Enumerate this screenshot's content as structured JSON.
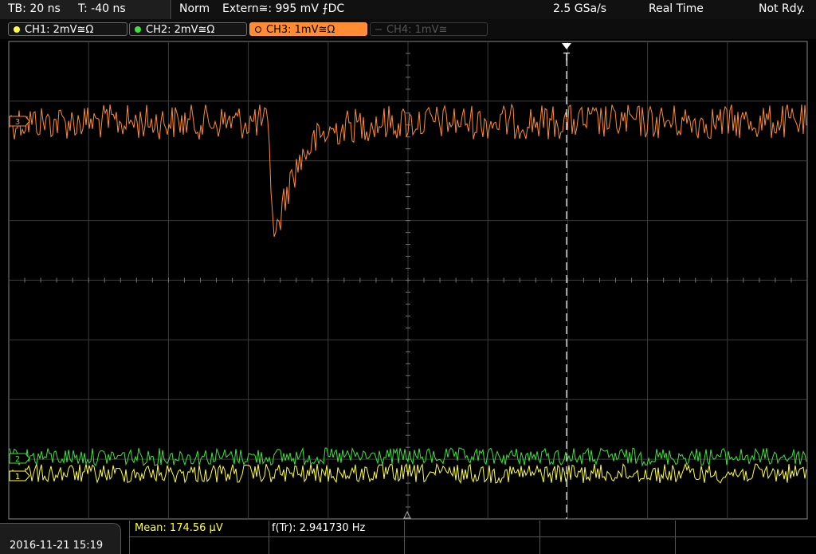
{
  "status_bar": {
    "timebase": "TB: 20 ns",
    "trigger_time": "T: -40 ns",
    "trigger_mode": "Norm",
    "trigger_source": "Extern≅: 995 mV ⨍DC",
    "sample_rate": "2.5 GSa/s",
    "acquisition_mode": "Real Time",
    "run_state": "Not Rdy."
  },
  "channels": [
    {
      "label": "CH1: 2mV≅Ω",
      "color": "#ffff40",
      "state": "on"
    },
    {
      "label": "CH2: 2mV≅Ω",
      "color": "#40e040",
      "state": "on"
    },
    {
      "label": "CH3: 1mV≅Ω",
      "color": "#ff8c32",
      "state": "active"
    },
    {
      "label": "CH4: 1mV≅",
      "color": "#555555",
      "state": "off"
    }
  ],
  "markers": {
    "ch1": "1",
    "ch2": "2",
    "ch3": "3",
    "trigger": "T"
  },
  "footer": {
    "datetime": "2016-11-21 15:19",
    "mean": "Mean: 174.56 µV",
    "frequency": "f(Tr): 2.941730 Hz"
  },
  "colors": {
    "ch1": "#ffff40",
    "ch2": "#40e040",
    "ch3": "#ff8c32",
    "grid": "#3c3c3c"
  }
}
